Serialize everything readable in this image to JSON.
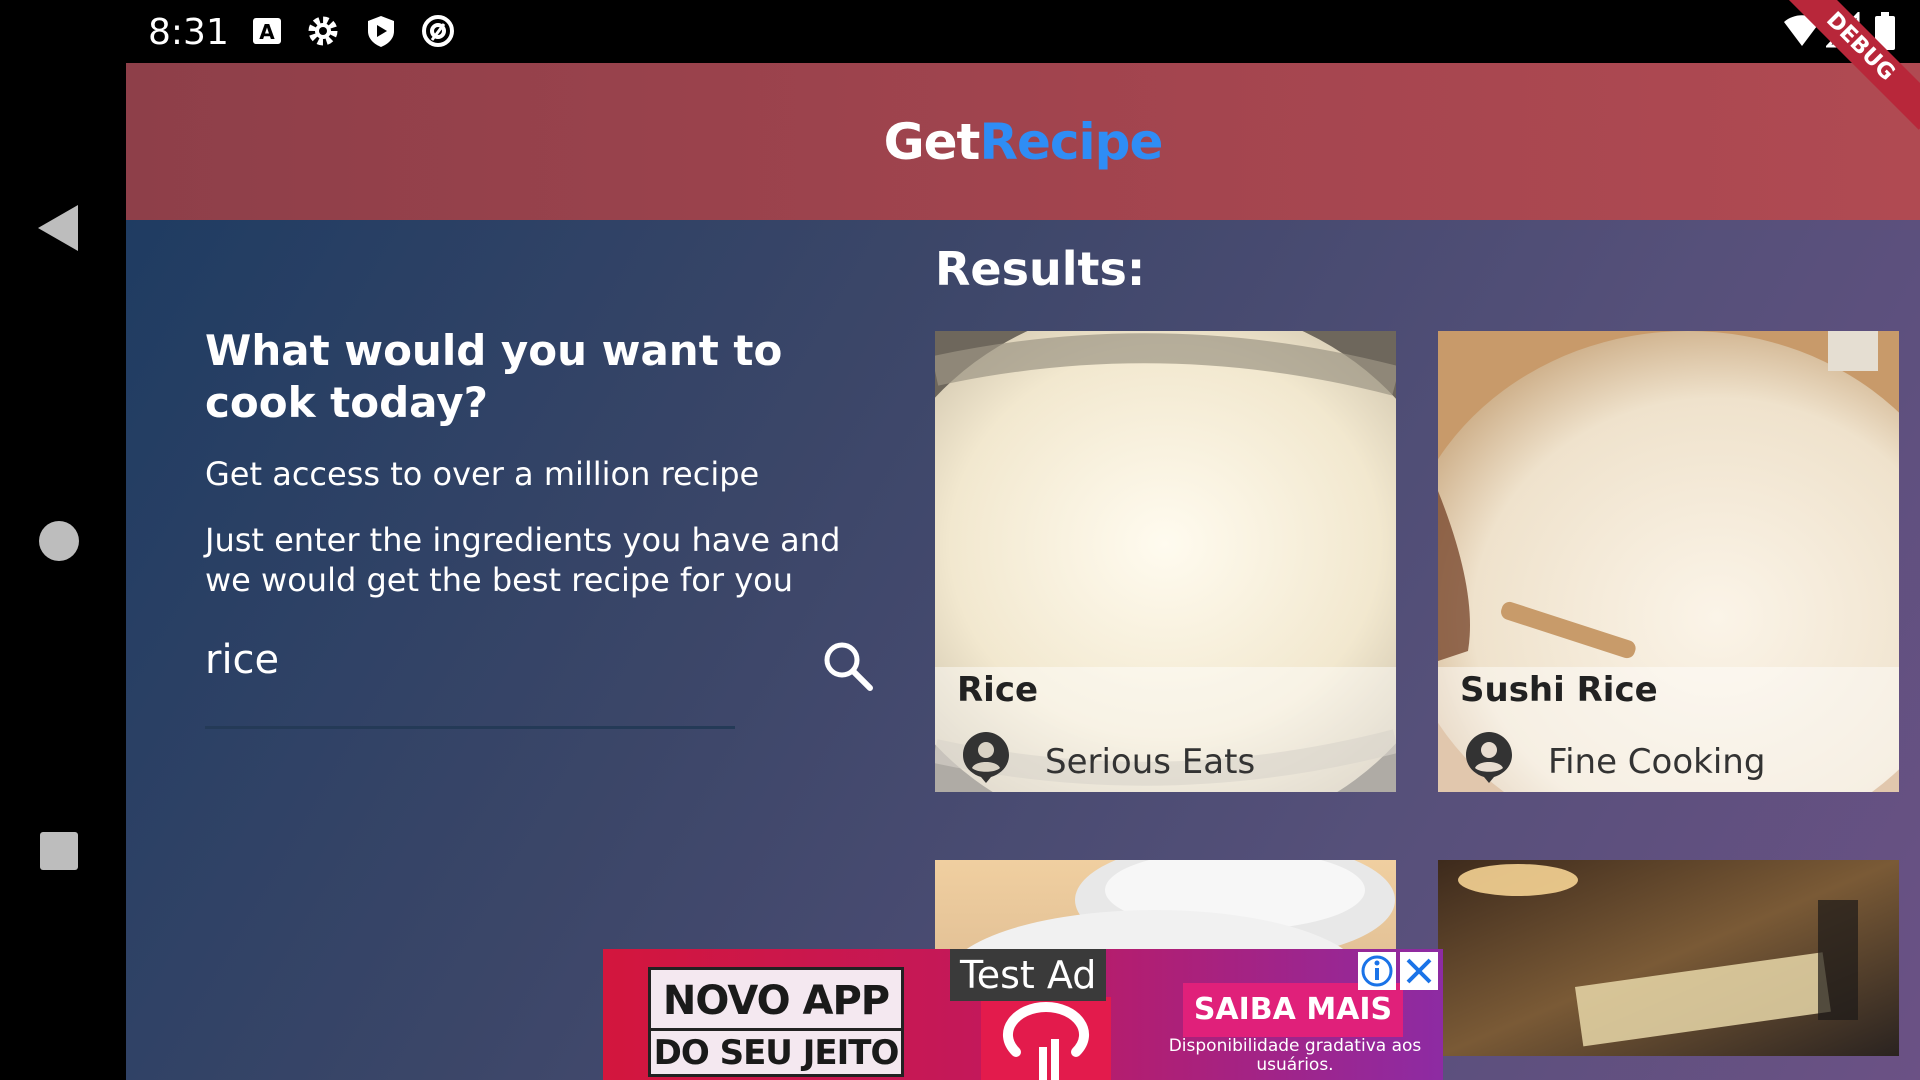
{
  "status_bar": {
    "time": "8:31",
    "left_icons": [
      "a-keyboard-icon",
      "gear-icon",
      "play-protect-icon",
      "at-sign-icon"
    ],
    "right_icons": [
      "wifi-icon",
      "signal-icon",
      "battery-icon"
    ]
  },
  "debug_banner": "DEBUG",
  "app_bar": {
    "title_part1": "Get",
    "title_part2": "Recipe",
    "title_color1": "#ffffff",
    "title_color2": "#2f8df5",
    "background": "#a4454f"
  },
  "intro": {
    "headline": "What would you want to cook today?",
    "subtitle": "Get access to over a million recipe",
    "description": "Just enter the ingredients you have and we would get the best recipe for you"
  },
  "search": {
    "value": "rice",
    "icon": "search-icon"
  },
  "results": {
    "heading": "Results:",
    "cards": [
      {
        "title": "Rice",
        "source": "Serious Eats"
      },
      {
        "title": "Sushi Rice",
        "source": "Fine Cooking"
      },
      {
        "title": "",
        "source": ""
      },
      {
        "title": "",
        "source": ""
      }
    ]
  },
  "ad": {
    "label": "Test Ad",
    "left_line1": "NOVO APP",
    "left_line2": "DO SEU JEITO",
    "cta": "SAIBA MAIS",
    "disclaimer": "Disponibilidade gradativa aos usuários."
  },
  "nav_bar": {
    "buttons": [
      "back-icon",
      "home-icon",
      "recents-icon"
    ]
  }
}
